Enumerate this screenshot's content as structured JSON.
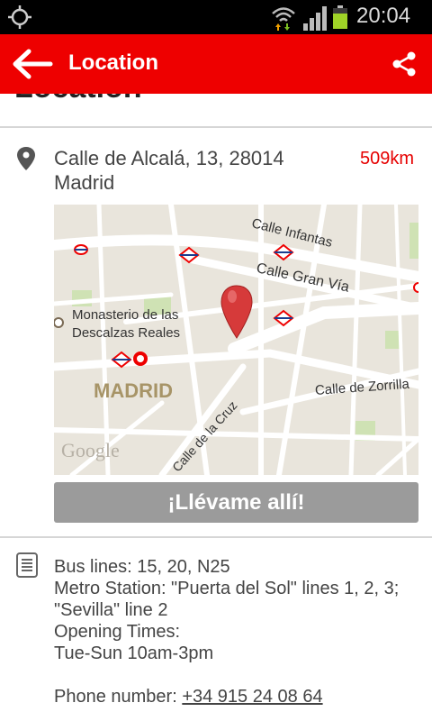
{
  "status_bar": {
    "time": "20:04",
    "icons": [
      "gps-icon",
      "wifi-icon",
      "signal-icon",
      "battery-icon"
    ]
  },
  "action_bar": {
    "title": "Location",
    "back_icon": "arrow-left-icon",
    "share_icon": "share-icon",
    "background": "#ee0000"
  },
  "section": {
    "heading": "Location"
  },
  "address": {
    "line1": "Calle de Alcalá, 13, 28014",
    "line2": "Madrid",
    "distance": "509km",
    "distance_color": "#e60000"
  },
  "map": {
    "labels": {
      "infantas": "Calle Infantas",
      "gran_via": "Calle Gran Vía",
      "monasterio1": "Monasterio de las",
      "monasterio2": "Descalzas Reales",
      "madrid": "MADRID",
      "zorrilla": "Calle de Zorrilla",
      "cruz": "Calle de la Cruz",
      "google": "Google"
    }
  },
  "button": {
    "label": "¡Llévame allí!"
  },
  "info": {
    "bus": "Bus lines: 15, 20, N25",
    "metro1": "Metro Station: \"Puerta del Sol\" lines 1, 2, 3;",
    "metro2": "\"Sevilla\" line 2",
    "opening_label": "Opening Times:",
    "opening_hours": "Tue-Sun 10am-3pm",
    "phone_label": "Phone number:",
    "phone": "+34 915 24 08 64"
  }
}
